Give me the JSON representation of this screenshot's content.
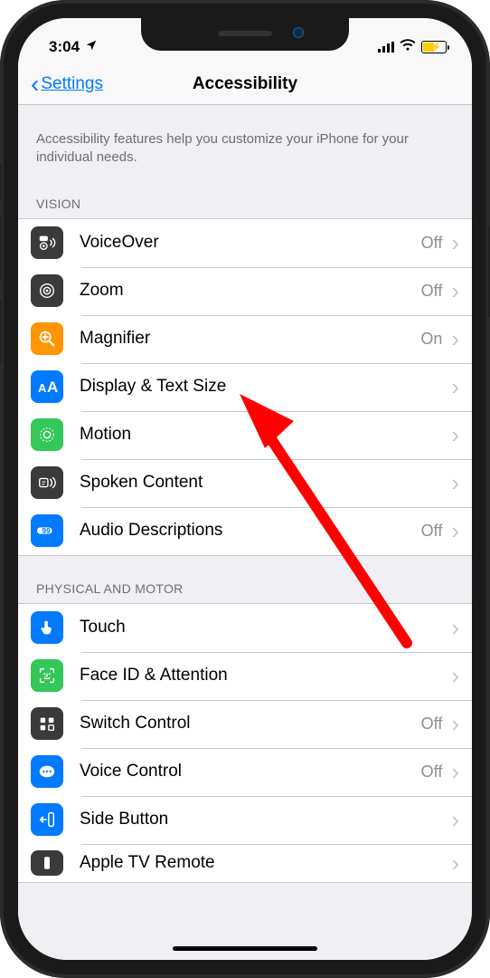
{
  "status": {
    "time": "3:04"
  },
  "nav": {
    "back_label": "Settings",
    "title": "Accessibility"
  },
  "desc": "Accessibility features help you customize your iPhone for your individual needs.",
  "sections": {
    "vision": {
      "header": "VISION",
      "items": [
        {
          "label": "VoiceOver",
          "value": "Off",
          "icon": "voiceover-icon"
        },
        {
          "label": "Zoom",
          "value": "Off",
          "icon": "zoom-icon"
        },
        {
          "label": "Magnifier",
          "value": "On",
          "icon": "magnifier-icon"
        },
        {
          "label": "Display & Text Size",
          "value": "",
          "icon": "display-text-icon"
        },
        {
          "label": "Motion",
          "value": "",
          "icon": "motion-icon"
        },
        {
          "label": "Spoken Content",
          "value": "",
          "icon": "spoken-content-icon"
        },
        {
          "label": "Audio Descriptions",
          "value": "Off",
          "icon": "audio-descriptions-icon"
        }
      ]
    },
    "physical": {
      "header": "PHYSICAL AND MOTOR",
      "items": [
        {
          "label": "Touch",
          "value": "",
          "icon": "touch-icon"
        },
        {
          "label": "Face ID & Attention",
          "value": "",
          "icon": "faceid-icon"
        },
        {
          "label": "Switch Control",
          "value": "Off",
          "icon": "switch-control-icon"
        },
        {
          "label": "Voice Control",
          "value": "Off",
          "icon": "voice-control-icon"
        },
        {
          "label": "Side Button",
          "value": "",
          "icon": "side-button-icon"
        },
        {
          "label": "Apple TV Remote",
          "value": "",
          "icon": "apple-tv-remote-icon"
        }
      ]
    }
  }
}
